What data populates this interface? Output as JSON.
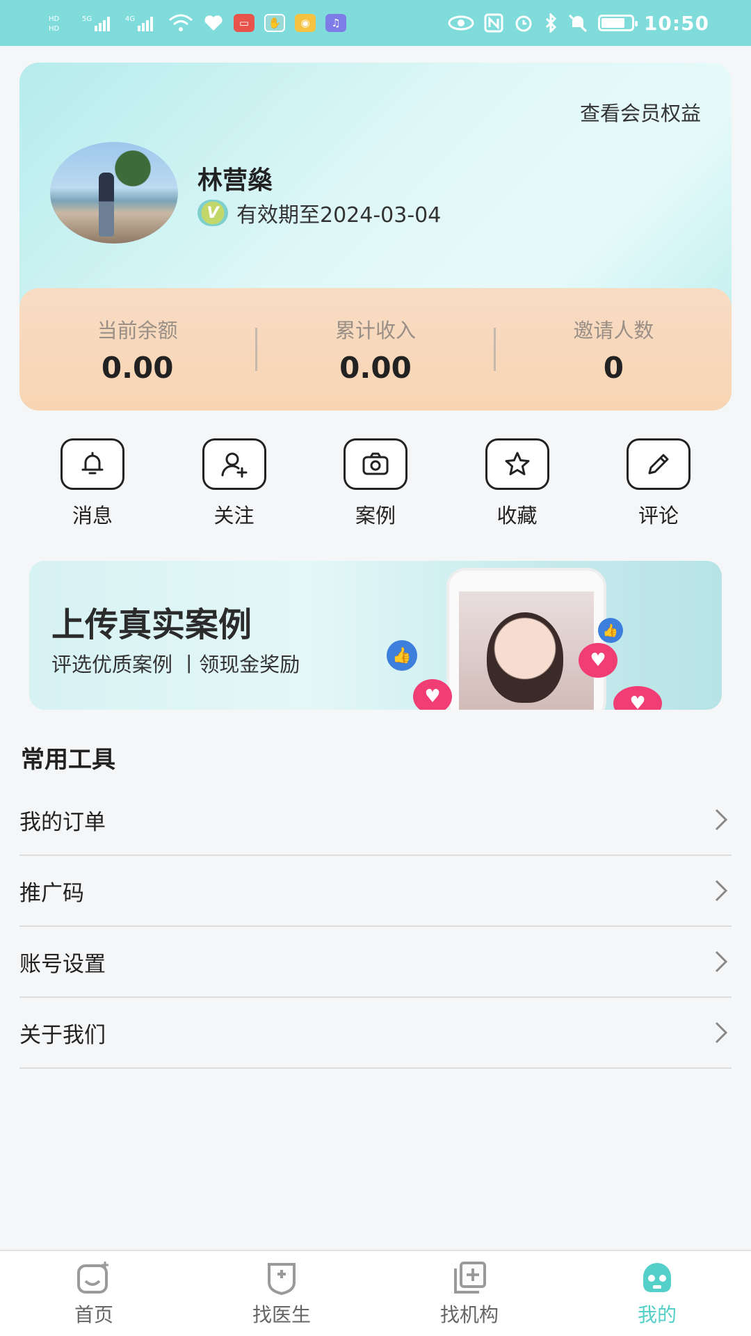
{
  "status_bar": {
    "left_icons": [
      "hd-signal-icon",
      "5g-signal-icon",
      "4g-signal-icon",
      "wifi-icon",
      "health-heart-icon",
      "app-icon-1",
      "app-icon-2",
      "weibo-icon",
      "music-icon"
    ],
    "right_icons": [
      "eye-icon",
      "nfc-icon",
      "alarm-icon",
      "bluetooth-icon",
      "mute-icon",
      "battery-icon"
    ],
    "time": "10:50",
    "battery_level": 0.8
  },
  "member_card": {
    "benefits_link": "查看会员权益",
    "user_name": "林营燊",
    "vip_badge": "V",
    "expiry": "有效期至2024-03-04",
    "stats": [
      {
        "label": "当前余额",
        "value": "0.00"
      },
      {
        "label": "累计收入",
        "value": "0.00"
      },
      {
        "label": "邀请人数",
        "value": "0"
      }
    ]
  },
  "quick_actions": [
    {
      "label": "消息",
      "icon": "bell-icon"
    },
    {
      "label": "关注",
      "icon": "add-user-icon"
    },
    {
      "label": "案例",
      "icon": "camera-icon"
    },
    {
      "label": "收藏",
      "icon": "star-icon"
    },
    {
      "label": "评论",
      "icon": "pencil-icon"
    }
  ],
  "banner": {
    "title": "上传真实案例",
    "subtitle": "评选优质案例 丨领现金奖励"
  },
  "tools": {
    "title": "常用工具",
    "items": [
      {
        "label": "我的订单"
      },
      {
        "label": "推广码"
      },
      {
        "label": "账号设置"
      },
      {
        "label": "关于我们"
      }
    ]
  },
  "bottom_nav": {
    "items": [
      {
        "label": "首页",
        "icon": "home-icon"
      },
      {
        "label": "找医生",
        "icon": "doctor-icon"
      },
      {
        "label": "找机构",
        "icon": "institution-icon"
      },
      {
        "label": "我的",
        "icon": "profile-icon"
      }
    ],
    "active_index": 3,
    "active_color": "#55d0c8"
  },
  "colors": {
    "status_bar": "#7fdcdb",
    "stats_panel": "#f8d4b3",
    "accent": "#55d0c8"
  }
}
